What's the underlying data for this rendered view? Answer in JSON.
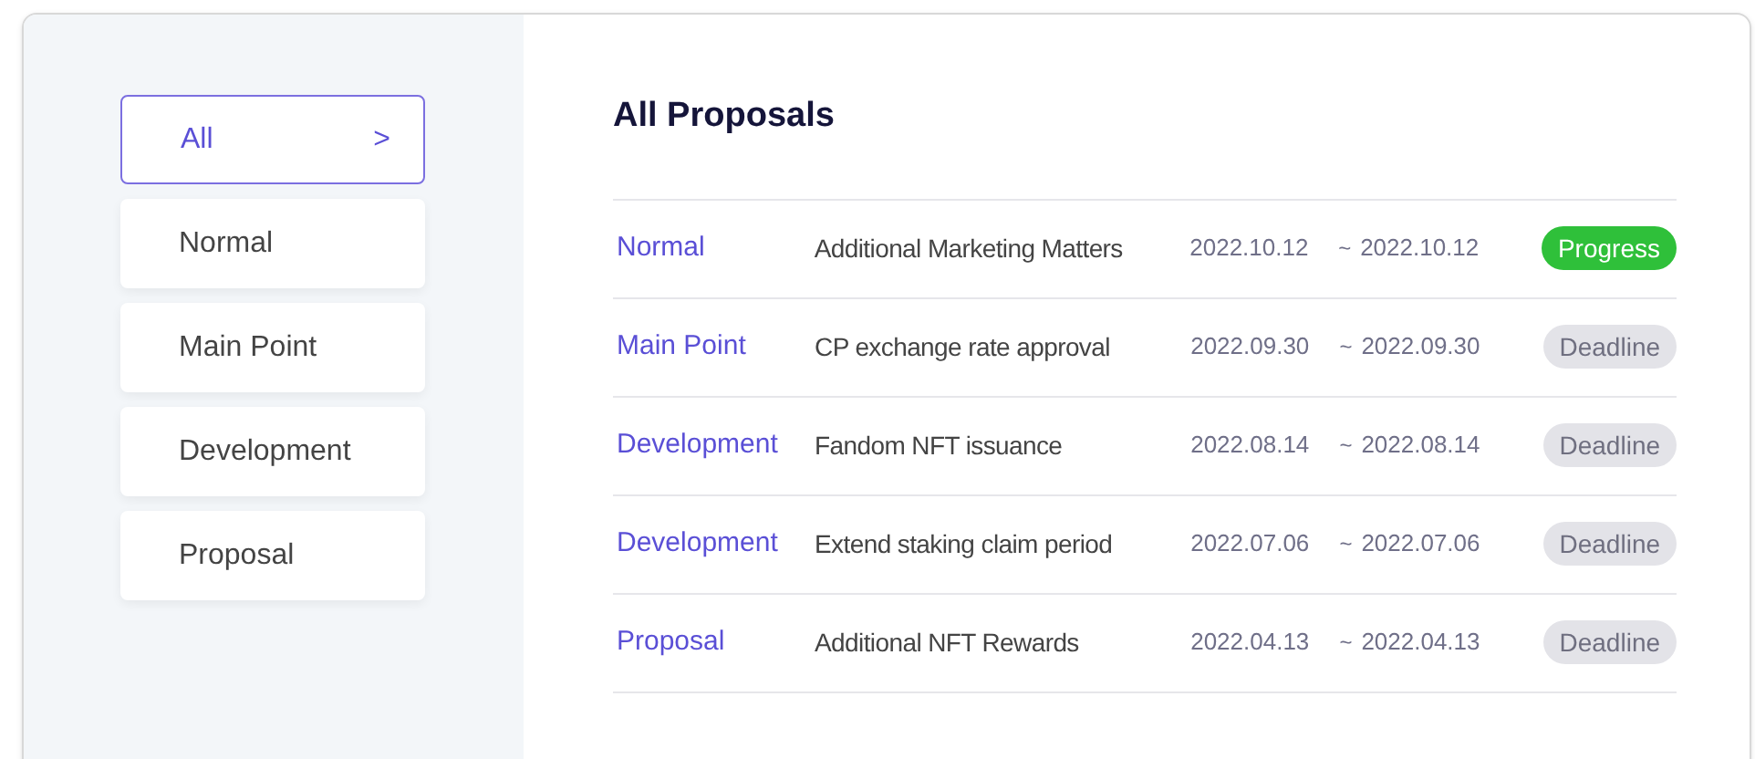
{
  "sidebar": {
    "selected_marker": ">",
    "items": [
      {
        "label": "All",
        "selected": true
      },
      {
        "label": "Normal",
        "selected": false
      },
      {
        "label": "Main Point",
        "selected": false
      },
      {
        "label": "Development",
        "selected": false
      },
      {
        "label": "Proposal",
        "selected": false
      }
    ]
  },
  "main": {
    "title": "All Proposals",
    "rows": [
      {
        "category": "Normal",
        "title": "Additional Marketing Matters",
        "start": "2022.10.12",
        "separator": "~",
        "end": "2022.10.12",
        "status": {
          "kind": "progress",
          "label": "Progress"
        }
      },
      {
        "category": "Main Point",
        "title": "CP exchange rate approval",
        "start": "2022.09.30",
        "separator": "~",
        "end": "2022.09.30",
        "status": {
          "kind": "deadline",
          "label": "Deadline"
        }
      },
      {
        "category": "Development",
        "title": "Fandom NFT issuance",
        "start": "2022.08.14",
        "separator": "~",
        "end": "2022.08.14",
        "status": {
          "kind": "deadline",
          "label": "Deadline"
        }
      },
      {
        "category": "Development",
        "title": "Extend staking claim period",
        "start": "2022.07.06",
        "separator": "~",
        "end": "2022.07.06",
        "status": {
          "kind": "deadline",
          "label": "Deadline"
        }
      },
      {
        "category": "Proposal",
        "title": "Additional NFT Rewards",
        "start": "2022.04.13",
        "separator": "~",
        "end": "2022.04.13",
        "status": {
          "kind": "deadline",
          "label": "Deadline"
        }
      }
    ]
  }
}
